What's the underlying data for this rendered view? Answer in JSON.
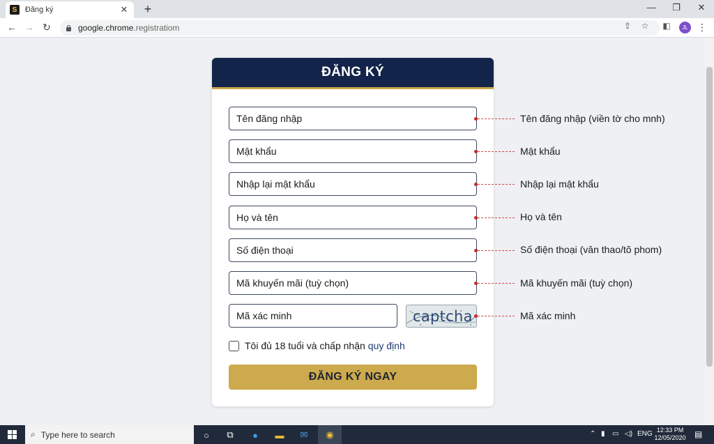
{
  "browser": {
    "tab_title": "Đăng ký",
    "favicon_letter": "S",
    "url_domain": "google.chrome",
    "url_rest": ".registratiom",
    "profile_initials": "JL"
  },
  "form": {
    "title": "ĐĂNG KÝ",
    "fields": [
      {
        "label": "Tên đăng nhập",
        "annotation": "Tên đăng nhập (viền tờ cho mnh)"
      },
      {
        "label": "Mật khẩu",
        "annotation": "Mật khẩu"
      },
      {
        "label": "Nhập lại mật khẩu",
        "annotation": "Nhập lại mật khẩu"
      },
      {
        "label": "Họ và tên",
        "annotation": "Họ và tên"
      },
      {
        "label": "Số điện thoại",
        "annotation": "Số điện thoại (văn thao/tõ phom)"
      },
      {
        "label": "Mã khuyến mãi (tuỳ chọn)",
        "annotation": "Mã khuyến mãi (tuỳ chọn)"
      },
      {
        "label": "Mã xác minh",
        "annotation": "Mã xác minh"
      }
    ],
    "captcha_text": "captcha",
    "agree_text": "Tôi đủ 18 tuổi và chấp nhận",
    "agree_link": "quy định",
    "submit_label": "ĐĂNG KÝ NGAY"
  },
  "taskbar": {
    "search_placeholder": "Type here to search",
    "language": "ENG",
    "time": "12:33 PM",
    "date": "12/05/2020"
  },
  "colors": {
    "header_navy": "#13244a",
    "gold": "#cdaa4d",
    "annotation_red": "#c22b2b"
  }
}
